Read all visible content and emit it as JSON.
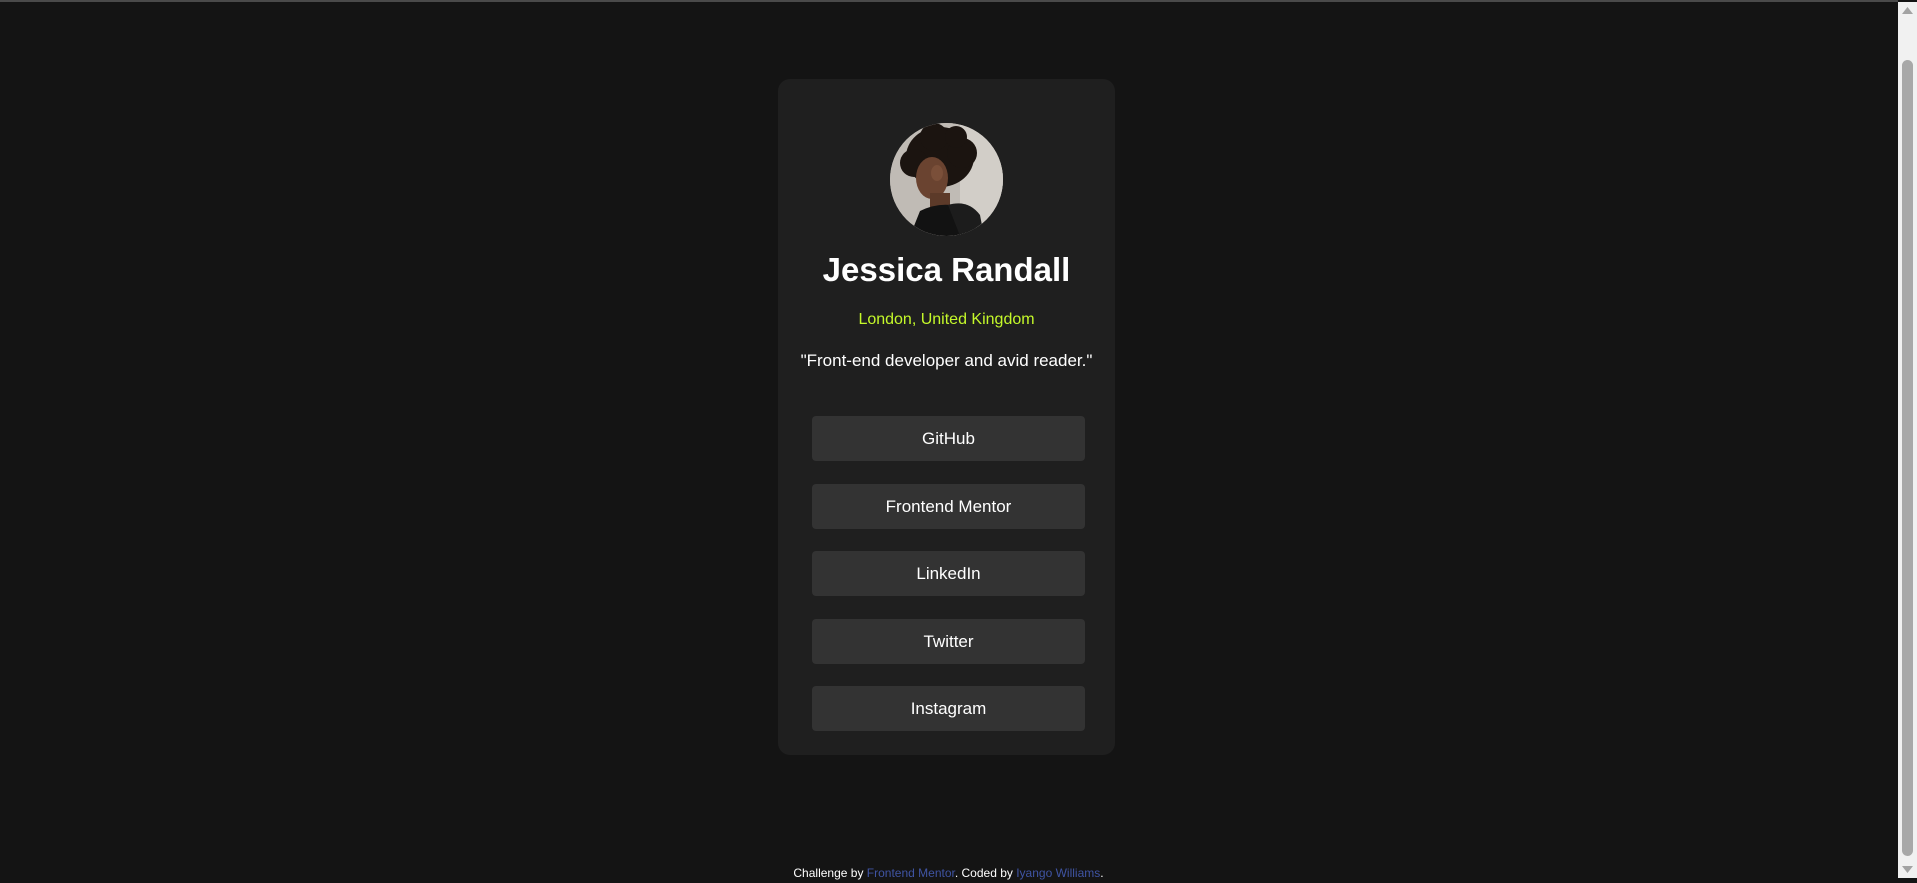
{
  "profile": {
    "name": "Jessica Randall",
    "location": "London, United Kingdom",
    "bio": "\"Front-end developer and avid reader.\""
  },
  "links": [
    {
      "label": "GitHub"
    },
    {
      "label": "Frontend Mentor"
    },
    {
      "label": "LinkedIn"
    },
    {
      "label": "Twitter"
    },
    {
      "label": "Instagram"
    }
  ],
  "footer": {
    "prefix": "Challenge by ",
    "challenge_link": "Frontend Mentor",
    "middle": ". Coded by ",
    "author_link": "Iyango Williams",
    "suffix": "."
  },
  "colors": {
    "background": "#141414",
    "card": "#1f1f1f",
    "button": "#333333",
    "accent": "#c4f82a",
    "footer_link": "#3f54a3"
  },
  "icons": {
    "scroll_up": "triangle-up-icon",
    "scroll_down": "triangle-down-icon"
  }
}
